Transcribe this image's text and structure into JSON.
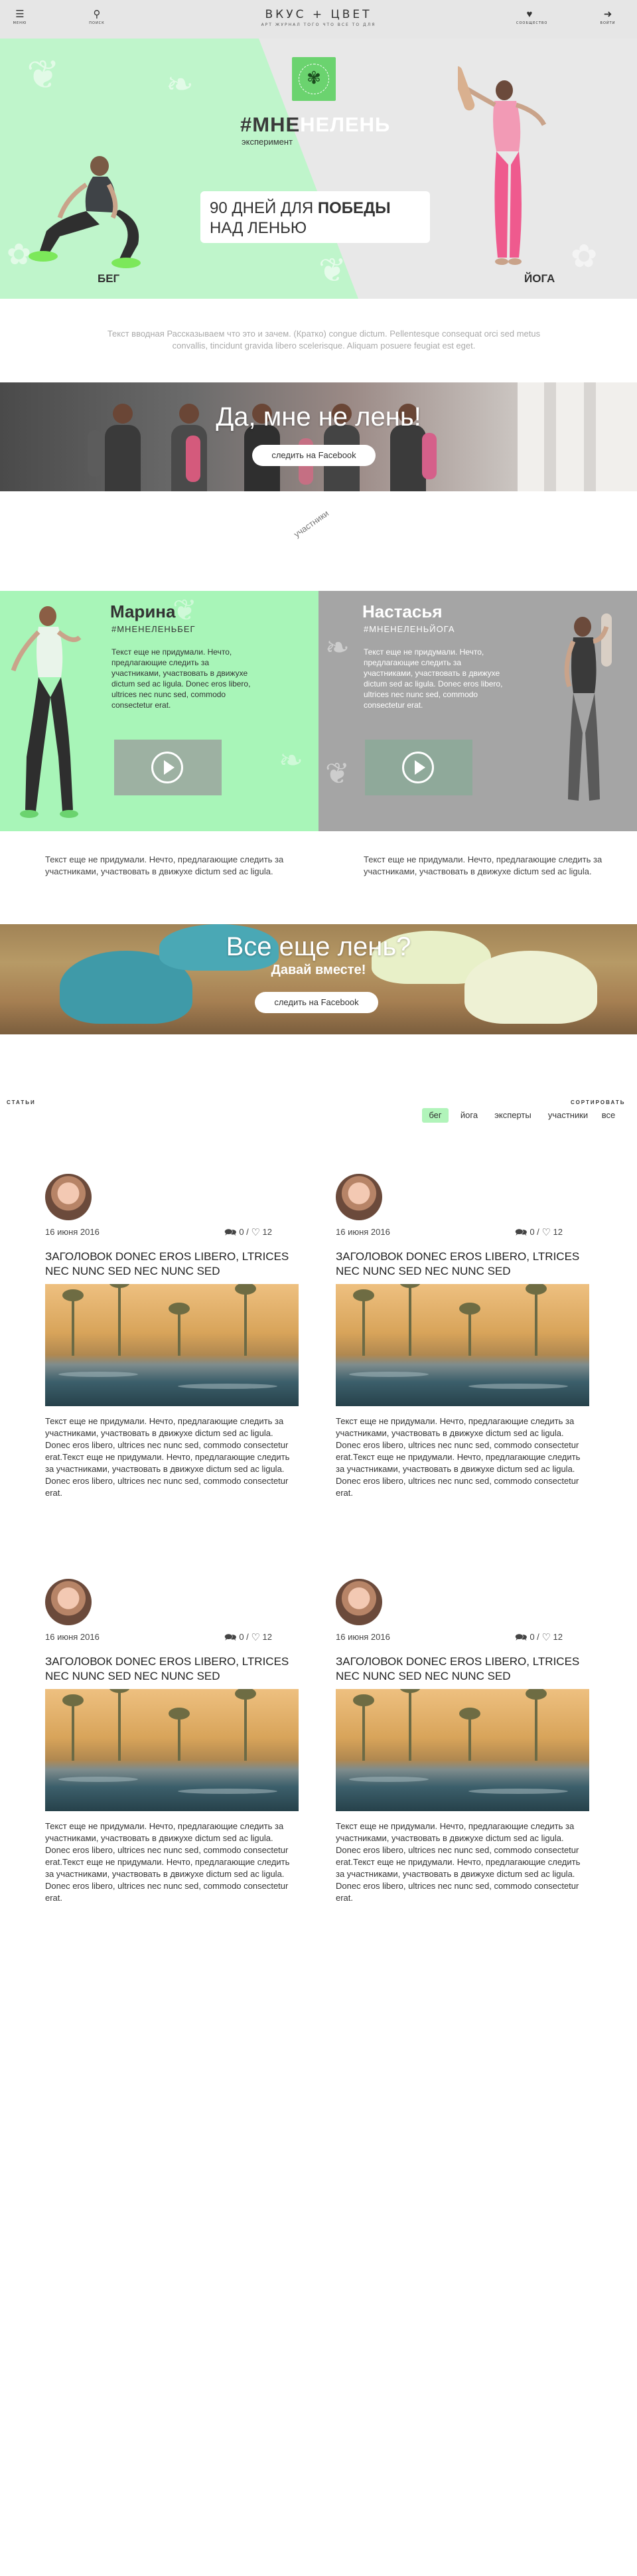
{
  "header": {
    "menu_icon": "hamburger-icon",
    "menu_caption": "МЕНЮ",
    "search_icon": "search-icon",
    "search_caption": "ПОИСК",
    "brand": "ВКУС + ЦВЕТ",
    "brand_sub": "АРТ ЖУРНАЛ ТОГО ЧТО ВСЕ ТО ДЛЯ",
    "community_icon": "community-icon",
    "community_caption": "СООБЩЕСТВО",
    "login_icon": "login-icon",
    "login_caption": "ВОЙТИ"
  },
  "hero": {
    "badge_icon": "leaf-badge-icon",
    "hashtag_dark": "#МНЕ",
    "hashtag_light": "НЕЛЕНЬ",
    "experiment": "эксперимент",
    "days_prefix": "90 ДНЕЙ ДЛЯ ",
    "days_bold": "ПОБЕДЫ",
    "days_line2": "НАД ЛЕНЬЮ",
    "label_run": "БЕГ",
    "label_yoga": "ЙОГА"
  },
  "intro": "Текст вводная Рассказываем что это и зачем. (Кратко) congue dictum. Pellentesque consequat orci sed metus convallis, tincidunt gravida libero scelerisque. Aliquam posuere feugiat est eget.",
  "banner1": {
    "title": "Да, мне не лень!",
    "button": "следить на Facebook"
  },
  "participants_label": "участники",
  "participants": [
    {
      "name": "Марина",
      "tag": "#МНЕНЕЛЕНЬБЕГ",
      "text": "Текст еще не придумали. Нечто, предлагающие следить за участниками, участвовать в движухе dictum sed ac ligula. Donec eros libero, ultrices nec nunc sed, commodo consectetur erat.",
      "play_icon": "play-icon",
      "below": "Текст еще не придумали. Нечто, предлагающие следить за участниками, участвовать в движухе dictum sed ac ligula."
    },
    {
      "name": "Настасья",
      "tag": "#МНЕНЕЛЕНЬЙОГА",
      "text": "Текст еще не придумали. Нечто, предлагающие следить за участниками, участвовать в движухе dictum sed ac ligula. Donec eros libero, ultrices nec nunc sed, commodo consectetur erat.",
      "play_icon": "play-icon",
      "below": "Текст еще не придумали. Нечто, предлагающие следить за участниками, участвовать в движухе dictum sed ac ligula."
    }
  ],
  "banner2": {
    "title": "Все еще лень?",
    "subtitle": "Давай вместе!",
    "button": "следить на Facebook"
  },
  "articles_section": {
    "label": "СТАТЬИ",
    "sort_label": "СОРТИРОВАТЬ",
    "filters": [
      "бег",
      "йога",
      "эксперты",
      "участники",
      "все"
    ],
    "active_filter": "бег"
  },
  "articles": [
    {
      "date": "16 июня 2016",
      "comments": "0",
      "likes": "12",
      "title": "ЗАГОЛОВОК DONEC EROS LIBERO, LTRICES NEC NUNC SED NEC NUNC SED",
      "text": "Текст еще не придумали. Нечто, предлагающие следить за участниками, участвовать в движухе dictum sed ac ligula. Donec eros libero, ultrices nec nunc sed, commodo consectetur erat.Текст еще не придумали. Нечто, предлагающие следить за участниками, участвовать в движухе dictum sed ac ligula. Donec eros libero, ultrices nec nunc sed, commodo consectetur erat."
    },
    {
      "date": "16 июня 2016",
      "comments": "0",
      "likes": "12",
      "title": "ЗАГОЛОВОК DONEC EROS LIBERO, LTRICES NEC NUNC SED NEC NUNC SED",
      "text": "Текст еще не придумали. Нечто, предлагающие следить за участниками, участвовать в движухе dictum sed ac ligula. Donec eros libero, ultrices nec nunc sed, commodo consectetur erat.Текст еще не придумали. Нечто, предлагающие следить за участниками, участвовать в движухе dictum sed ac ligula. Donec eros libero, ultrices nec nunc sed, commodo consectetur erat."
    },
    {
      "date": "16 июня 2016",
      "comments": "0",
      "likes": "12",
      "title": "ЗАГОЛОВОК DONEC EROS LIBERO, LTRICES NEC NUNC SED NEC NUNC SED",
      "text": "Текст еще не придумали. Нечто, предлагающие следить за участниками, участвовать в движухе dictum sed ac ligula. Donec eros libero, ultrices nec nunc sed, commodo consectetur erat.Текст еще не придумали. Нечто, предлагающие следить за участниками, участвовать в движухе dictum sed ac ligula. Donec eros libero, ultrices nec nunc sed, commodo consectetur erat."
    },
    {
      "date": "16 июня 2016",
      "comments": "0",
      "likes": "12",
      "title": "ЗАГОЛОВОК DONEC EROS LIBERO, LTRICES NEC NUNC SED NEC NUNC SED",
      "text": "Текст еще не придумали. Нечто, предлагающие следить за участниками, участвовать в движухе dictum sed ac ligula. Donec eros libero, ultrices nec nunc sed, commodo consectetur erat.Текст еще не придумали. Нечто, предлагающие следить за участниками, участвовать в движухе dictum sed ac ligula. Donec eros libero, ultrices nec nunc sed, commodo consectetur erat."
    }
  ],
  "colors": {
    "header_bg": "#e6e6e6",
    "mint": "#a8f5b8",
    "active_filter": "#b1f4ba",
    "gray_card": "#a5a5a5"
  }
}
